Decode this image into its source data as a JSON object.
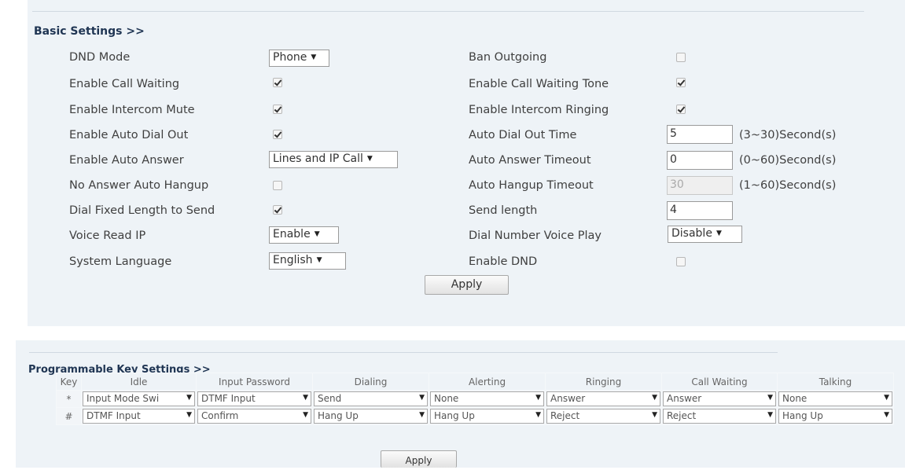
{
  "basic": {
    "title": "Basic Settings >>",
    "dnd_mode": {
      "label": "DND Mode",
      "value": "Phone"
    },
    "ban_outgoing": {
      "label": "Ban Outgoing",
      "checked": false
    },
    "call_waiting": {
      "label": "Enable Call Waiting",
      "checked": true
    },
    "call_waiting_tone": {
      "label": "Enable Call Waiting Tone",
      "checked": true
    },
    "intercom_mute": {
      "label": "Enable Intercom Mute",
      "checked": true
    },
    "intercom_ringing": {
      "label": "Enable Intercom Ringing",
      "checked": true
    },
    "auto_dial_out": {
      "label": "Enable Auto Dial Out",
      "checked": true
    },
    "auto_dial_out_time": {
      "label": "Auto Dial Out Time",
      "value": "5",
      "unit": "(3~30)Second(s)"
    },
    "auto_answer": {
      "label": "Enable Auto Answer",
      "value": "Lines and IP Call"
    },
    "auto_answer_timeout": {
      "label": "Auto Answer Timeout",
      "value": "0",
      "unit": "(0~60)Second(s)"
    },
    "no_answer_hangup": {
      "label": "No Answer Auto Hangup",
      "checked": false
    },
    "auto_hangup_timeout": {
      "label": "Auto Hangup Timeout",
      "value": "30",
      "unit": "(1~60)Second(s)"
    },
    "dial_fixed_length": {
      "label": "Dial Fixed Length to Send",
      "checked": true
    },
    "send_length": {
      "label": "Send length",
      "value": "4"
    },
    "voice_read_ip": {
      "label": "Voice Read IP",
      "value": "Enable"
    },
    "dial_number_voice": {
      "label": "Dial Number Voice Play",
      "value": "Disable"
    },
    "system_language": {
      "label": "System Language",
      "value": "English"
    },
    "enable_dnd": {
      "label": "Enable DND",
      "checked": false
    },
    "apply": "Apply"
  },
  "keys": {
    "title": "Programmable Key Settings >>",
    "headers": [
      "Key",
      "Idle",
      "Input Password",
      "Dialing",
      "Alerting",
      "Ringing",
      "Call Waiting",
      "Talking"
    ],
    "rows": [
      {
        "key": "*",
        "values": [
          "Input Mode Swi",
          "DTMF Input",
          "Send",
          "None",
          "Answer",
          "Answer",
          "None"
        ]
      },
      {
        "key": "#",
        "values": [
          "DTMF Input",
          "Confirm",
          "Hang Up",
          "Hang Up",
          "Reject",
          "Reject",
          "Hang Up"
        ]
      }
    ],
    "apply": "Apply"
  }
}
